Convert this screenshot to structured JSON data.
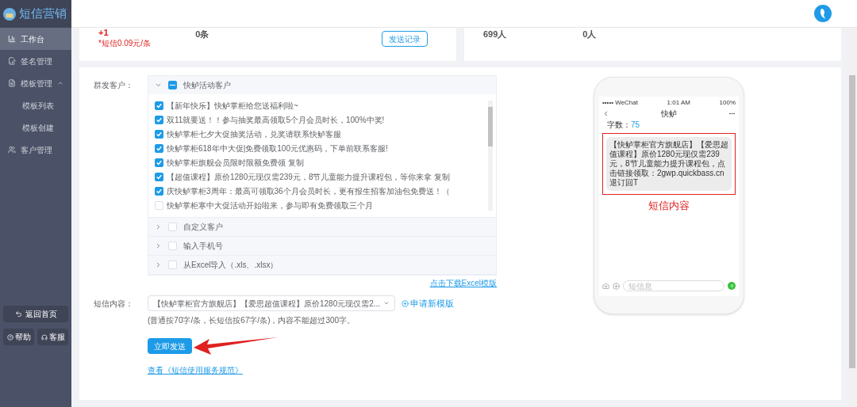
{
  "app": {
    "title": "短信营销"
  },
  "sidebar": {
    "items": [
      {
        "label": "工作台",
        "selected": true
      },
      {
        "label": "签名管理",
        "selected": false
      },
      {
        "label": "模板管理",
        "selected": false,
        "expanded": true,
        "children": [
          {
            "label": "模板列表",
            "selected": false
          },
          {
            "label": "模板创建",
            "selected": false
          }
        ]
      },
      {
        "label": "客户管理",
        "selected": false
      }
    ],
    "back_button": "返回首页",
    "help_button": "帮助",
    "service_button": "客服"
  },
  "stats": {
    "left": {
      "value": "+1",
      "unit_value": "0条",
      "price_note": "*短信0.09元/条",
      "record_button": "发送记录"
    },
    "right": {
      "value_1": "699人",
      "value_2": "0人"
    }
  },
  "form": {
    "recipients_label": "群发客户：",
    "groups": [
      {
        "label": "快鲈活动客户",
        "expanded": true,
        "checked": false,
        "indeterminate": true,
        "items": [
          {
            "label": "【新年快乐】快鲈掌柜给您送福利啦~",
            "checked": true
          },
          {
            "label": "双11就要送！！参与抽奖最高领取5个月会员时长，100%中奖!",
            "checked": true
          },
          {
            "label": "快鲈掌柜七夕大促抽奖活动，兑奖请联系快鲈客服",
            "checked": true
          },
          {
            "label": "快鲈掌柜618年中大促|免费领取100元优惠码，下单前联系客服!",
            "checked": true
          },
          {
            "label": "快鲈掌柜旗舰会员限时限额免费领 复制",
            "checked": true
          },
          {
            "label": "【超值课程】原价1280元现仅需239元，8节儿童能力提升课程包，等你来拿 复制",
            "checked": true
          },
          {
            "label": "庆快鲈掌柜3周年：最高可领取36个月会员时长，更有报生招客加油包免费送！（",
            "checked": true
          },
          {
            "label": "快鲈掌柜寒中大促活动开始啦来，参与即有免费领取三个月",
            "checked": false
          }
        ]
      },
      {
        "label": "自定义客户",
        "expanded": false,
        "checked": false,
        "indeterminate": false
      },
      {
        "label": "输入手机号",
        "expanded": false,
        "checked": false,
        "indeterminate": false
      },
      {
        "label": "从Excel导入（.xls、.xlsx）",
        "expanded": false,
        "checked": false,
        "indeterminate": false
      }
    ],
    "excel_link": "点击下载Excel模版",
    "content_label": "短信内容：",
    "content_value": "【快鲈掌柜官方旗舰店】【爱思超值课程】原价1280元现仅需2...",
    "new_template_link": "申请新模版",
    "hint": "(普通按70字/条，长短信按67字/条)，内容不能超过300字。",
    "send_button": "立即发送",
    "terms_link": "查看《短信使用服务规范》"
  },
  "phone": {
    "carrier": "••••• WeChat",
    "time": "1:01 AM",
    "battery": "100%",
    "title": "快鲈",
    "count_label": "字数：",
    "count": "75",
    "message": "【快鲈掌柜官方旗舰店】【爱思超值课程】原价1280元现仅需239元，8节儿童能力提升课程包，点击链接领取：2gwp.quickbass.cn 退订回T",
    "input_placeholder": "短信息"
  },
  "annotation": {
    "label": "短信内容"
  }
}
